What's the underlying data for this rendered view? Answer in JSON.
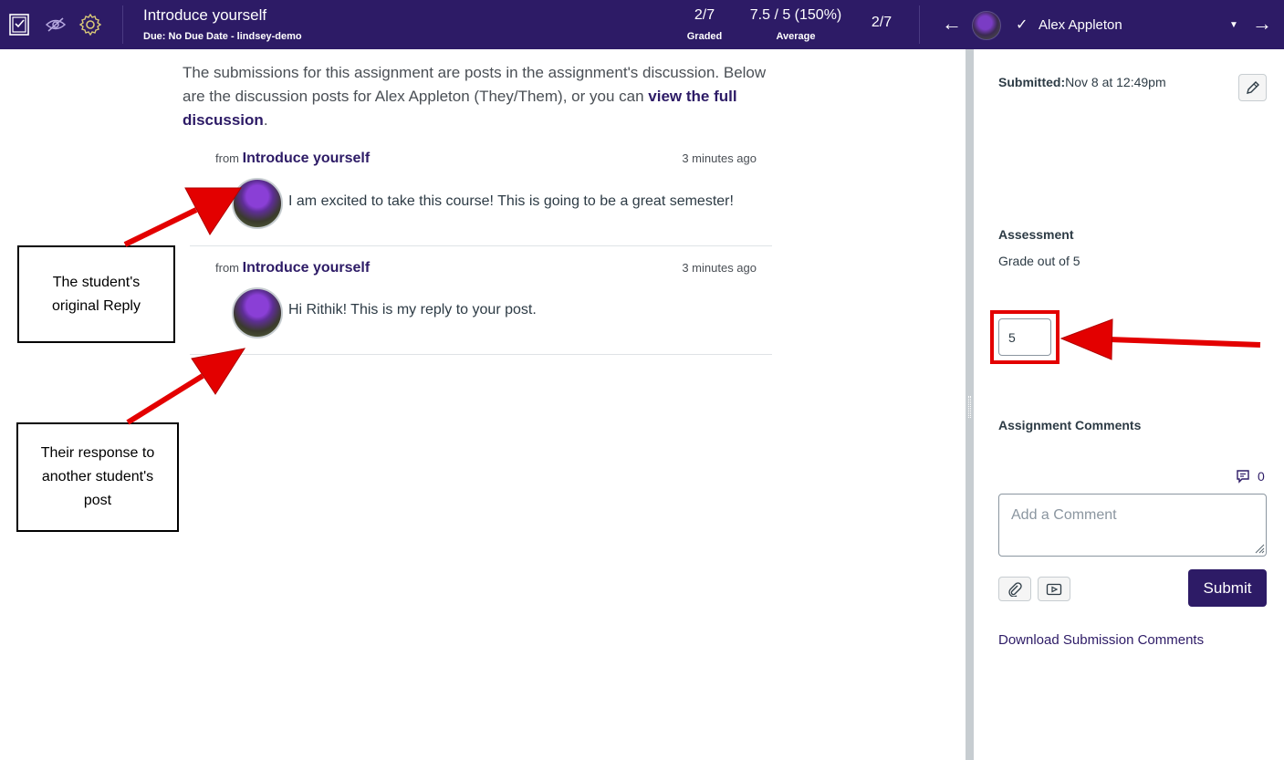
{
  "header": {
    "title": "Introduce yourself",
    "due": "Due: No Due Date - lindsey-demo",
    "graded_value": "2/7",
    "graded_label": "Graded",
    "average_value": "7.5 / 5 (150%)",
    "average_label": "Average",
    "position": "2/7",
    "student_name": "Alex Appleton",
    "prev_arrow": "←",
    "next_arrow": "→",
    "check": "✓",
    "caret": "▼",
    "icons": [
      "speedgrader-icon",
      "eye-slash-icon",
      "gear-icon"
    ]
  },
  "main": {
    "intro_text": "The submissions for this assignment are posts in the assignment's discussion. Below are the discussion posts for Alex Appleton (They/Them), or you can ",
    "intro_link": "view the full discussion",
    "intro_end": ".",
    "posts": [
      {
        "from_label": "from",
        "from_link": "Introduce yourself",
        "time": "3 minutes ago",
        "message": "I am excited to take this course! This is going to be a great semester!"
      },
      {
        "from_label": "from",
        "from_link": "Introduce yourself",
        "time": "3 minutes ago",
        "message": "Hi Rithik! This is my reply to your post."
      }
    ]
  },
  "annotations": {
    "box1": "The student's original Reply",
    "box2": "Their response to another student's post",
    "arrow_color": "#e30000"
  },
  "sidebar": {
    "submitted_label": "Submitted:",
    "submitted_value": "Nov 8 at 12:49pm",
    "assessment_heading": "Assessment",
    "grade_label": "Grade out of 5",
    "grade_value": "5",
    "comments_heading": "Assignment Comments",
    "comment_count": "0",
    "comment_placeholder": "Add a Comment",
    "submit_label": "Submit",
    "download_link": "Download Submission Comments"
  },
  "colors": {
    "brand": "#2d1b66",
    "highlight": "#e30000"
  }
}
